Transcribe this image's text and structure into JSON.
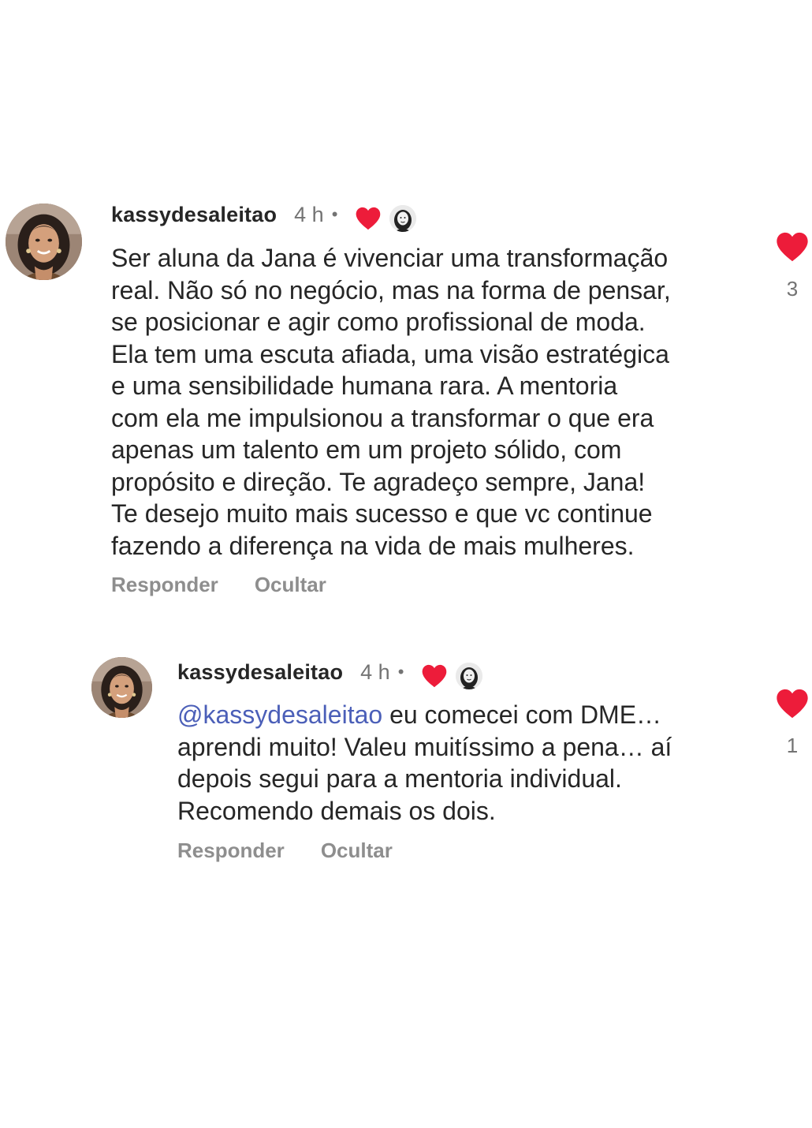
{
  "comments": [
    {
      "username": "kassydesaleitao",
      "time": "4 h",
      "separator": "•",
      "text": "Ser aluna da Jana é vivenciar uma transformação\nreal. Não só no negócio, mas na forma de pensar,\nse posicionar e agir como profissional de moda.\nEla tem uma escuta afiada, uma visão estratégica\ne uma sensibilidade humana rara. A mentoria\ncom ela me impulsionou a transformar o que era\napenas um talento em um projeto sólido, com\npropósito e direção. Te agradeço sempre, Jana!\nTe desejo muito mais sucesso e que vc continue\nfazendo a diferença na vida de mais mulheres.",
      "reply_label": "Responder",
      "hide_label": "Ocultar",
      "like_count": "3",
      "like_icon": "heart-filled-icon",
      "liked_by_creator": true
    },
    {
      "username": "kassydesaleitao",
      "time": "4 h",
      "separator": "•",
      "mention": "@kassydesaleitao",
      "text": " eu comecei com DME…\naprendi muito! Valeu muitíssimo a pena… aí\ndepois segui para a mentoria individual.\nRecomendo demais os dois.",
      "reply_label": "Responder",
      "hide_label": "Ocultar",
      "like_count": "1",
      "like_icon": "heart-filled-icon",
      "liked_by_creator": true
    }
  ],
  "colors": {
    "heart": "#ed1c3a",
    "mention": "#4b5fb8",
    "secondary_text": "#737373",
    "action_text": "#8e8e8e"
  }
}
